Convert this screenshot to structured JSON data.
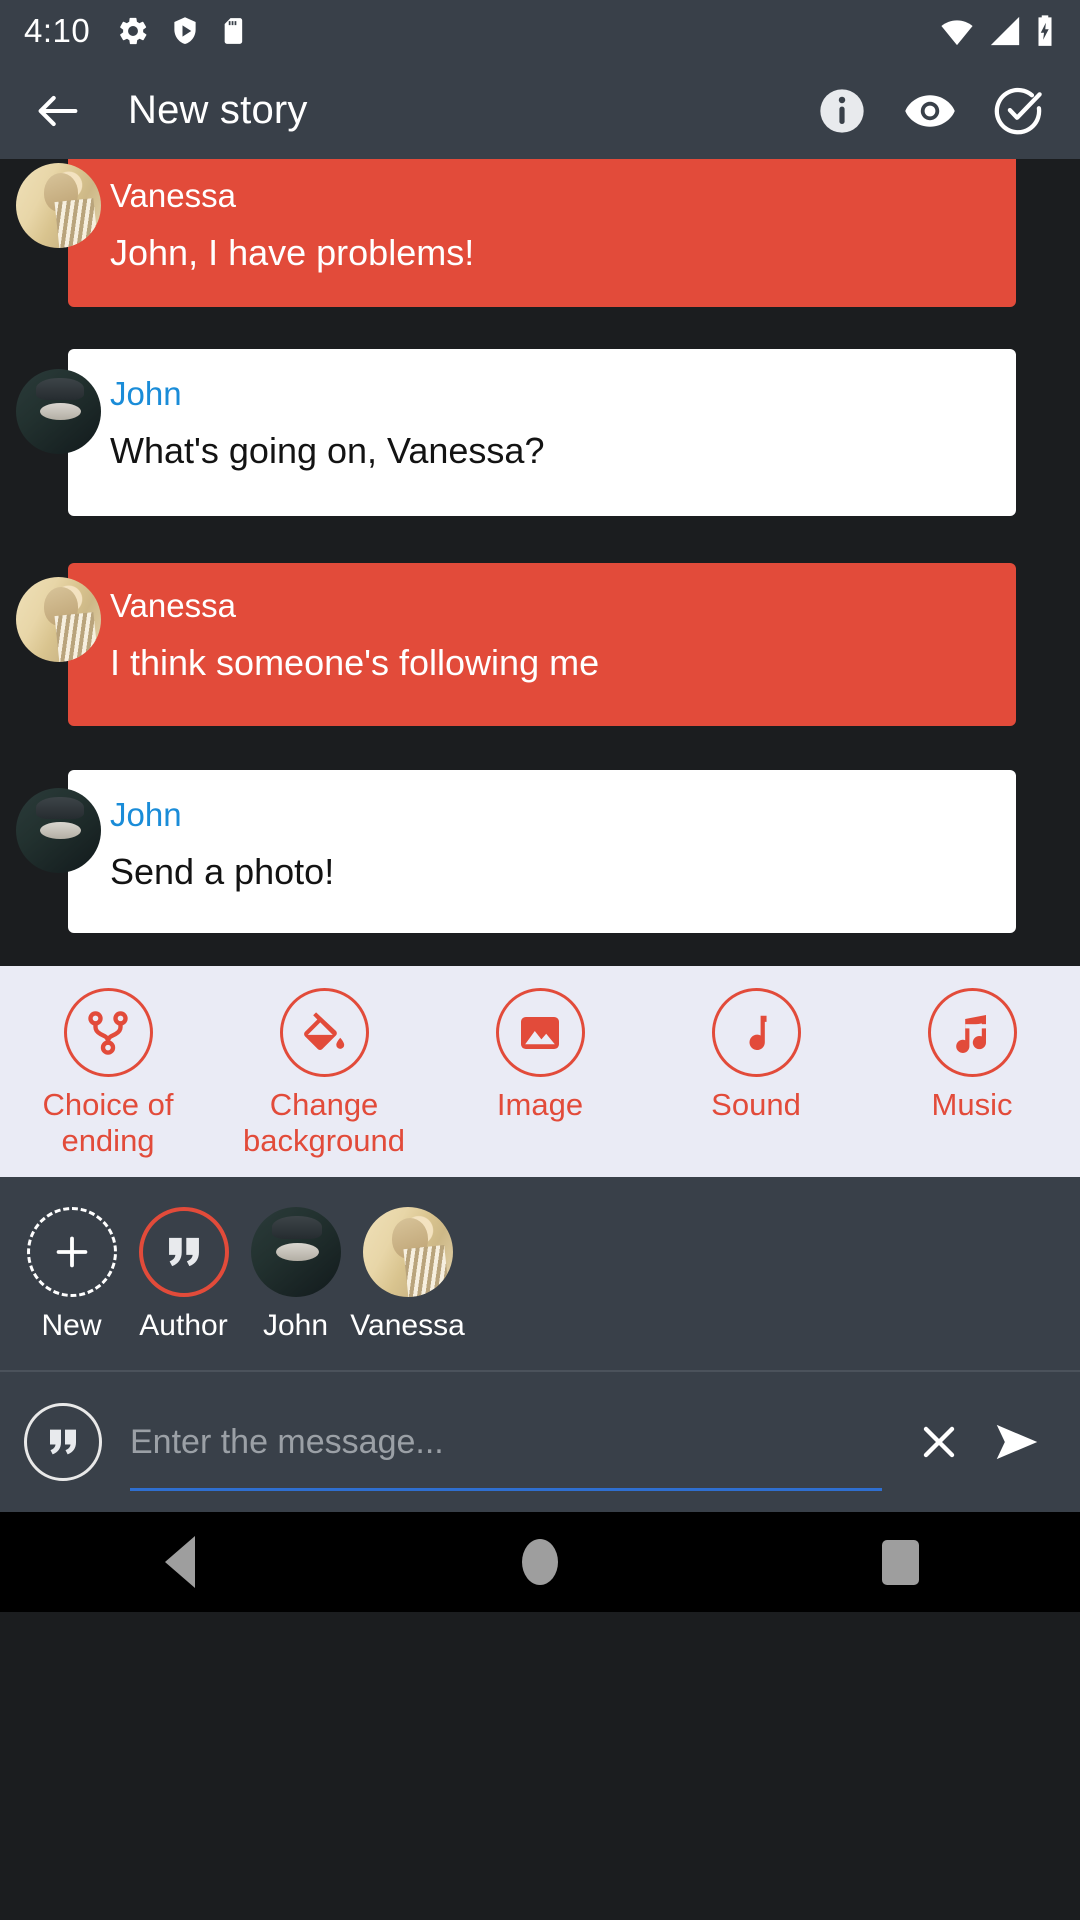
{
  "status_bar": {
    "time": "4:10",
    "left_icons": [
      "gear-icon",
      "shield-play-icon",
      "sd-card-icon"
    ],
    "right_icons": [
      "wifi-icon",
      "signal-icon",
      "battery-charging-icon"
    ]
  },
  "app_bar": {
    "back_icon": "back-arrow-icon",
    "title": "New story",
    "actions": [
      {
        "name": "info-icon",
        "label": "Info"
      },
      {
        "name": "eye-icon",
        "label": "Preview"
      },
      {
        "name": "check-circle-icon",
        "label": "Done"
      }
    ]
  },
  "chat": {
    "messages": [
      {
        "sender": "Vanessa",
        "text": "John, I have problems!",
        "style": "vanessa",
        "avatar": "av-vanessa",
        "clipped_top": true
      },
      {
        "sender": "John",
        "text": "What's going on, Vanessa?",
        "style": "john",
        "avatar": "av-john",
        "clipped_top": false
      },
      {
        "sender": "Vanessa",
        "text": "I think someone's following me",
        "style": "vanessa",
        "avatar": "av-vanessa",
        "clipped_top": false
      },
      {
        "sender": "John",
        "text": "Send a photo!",
        "style": "john",
        "avatar": "av-john",
        "clipped_top": false
      }
    ]
  },
  "action_toolbar": {
    "items": [
      {
        "icon": "branch-fork-icon",
        "label": "Choice of ending"
      },
      {
        "icon": "paint-bucket-icon",
        "label": "Change background"
      },
      {
        "icon": "image-icon",
        "label": "Image"
      },
      {
        "icon": "music-note-icon",
        "label": "Sound"
      },
      {
        "icon": "double-music-note-icon",
        "label": "Music"
      }
    ]
  },
  "character_row": {
    "items": [
      {
        "type": "new",
        "icon": "plus-icon",
        "label": "New"
      },
      {
        "type": "author",
        "icon": "quote-icon",
        "label": "Author"
      },
      {
        "type": "avatar",
        "icon": "av-john",
        "label": "John"
      },
      {
        "type": "avatar",
        "icon": "av-vanessa",
        "label": "Vanessa"
      }
    ]
  },
  "input_bar": {
    "speaker_icon": "quote-icon",
    "placeholder": "Enter the message...",
    "value": "",
    "clear_icon": "close-icon",
    "send_icon": "send-icon"
  },
  "nav_bar": {
    "buttons": [
      {
        "icon": "nav-back-icon",
        "label": "Back"
      },
      {
        "icon": "nav-home-icon",
        "label": "Home"
      },
      {
        "icon": "nav-recents-icon",
        "label": "Recents"
      }
    ]
  },
  "colors": {
    "accent": "#e24b3a",
    "chrome": "#394049",
    "chat_background": "#1b1d1f",
    "toolbar_background": "#eaebf5",
    "link": "#1a8cd8",
    "input_underline": "#2f6fd0"
  }
}
